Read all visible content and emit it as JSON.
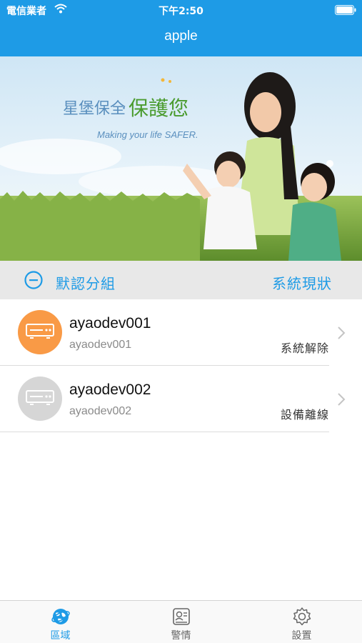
{
  "status_bar": {
    "carrier": "電信業者",
    "time": "下午2:50"
  },
  "nav": {
    "title": "apple"
  },
  "banner": {
    "brand_text_a": "星堡保全",
    "brand_text_b": "保護您",
    "tagline": "Making your life SAFER."
  },
  "group": {
    "name": "默認分組",
    "status_link": "系統現狀"
  },
  "devices": [
    {
      "name": "ayaodev001",
      "subtitle": "ayaodev001",
      "state": "系統解除",
      "avatar_color": "#f99a46"
    },
    {
      "name": "ayaodev002",
      "subtitle": "ayaodev002",
      "state": "設備離線",
      "avatar_color": "#d6d6d6"
    }
  ],
  "tabs": [
    {
      "label": "區域",
      "icon": "globe-icon",
      "active": true
    },
    {
      "label": "警情",
      "icon": "alert-list-icon",
      "active": false
    },
    {
      "label": "設置",
      "icon": "gear-icon",
      "active": false
    }
  ],
  "colors": {
    "accent": "#1e9be6",
    "inactive": "#666666"
  }
}
